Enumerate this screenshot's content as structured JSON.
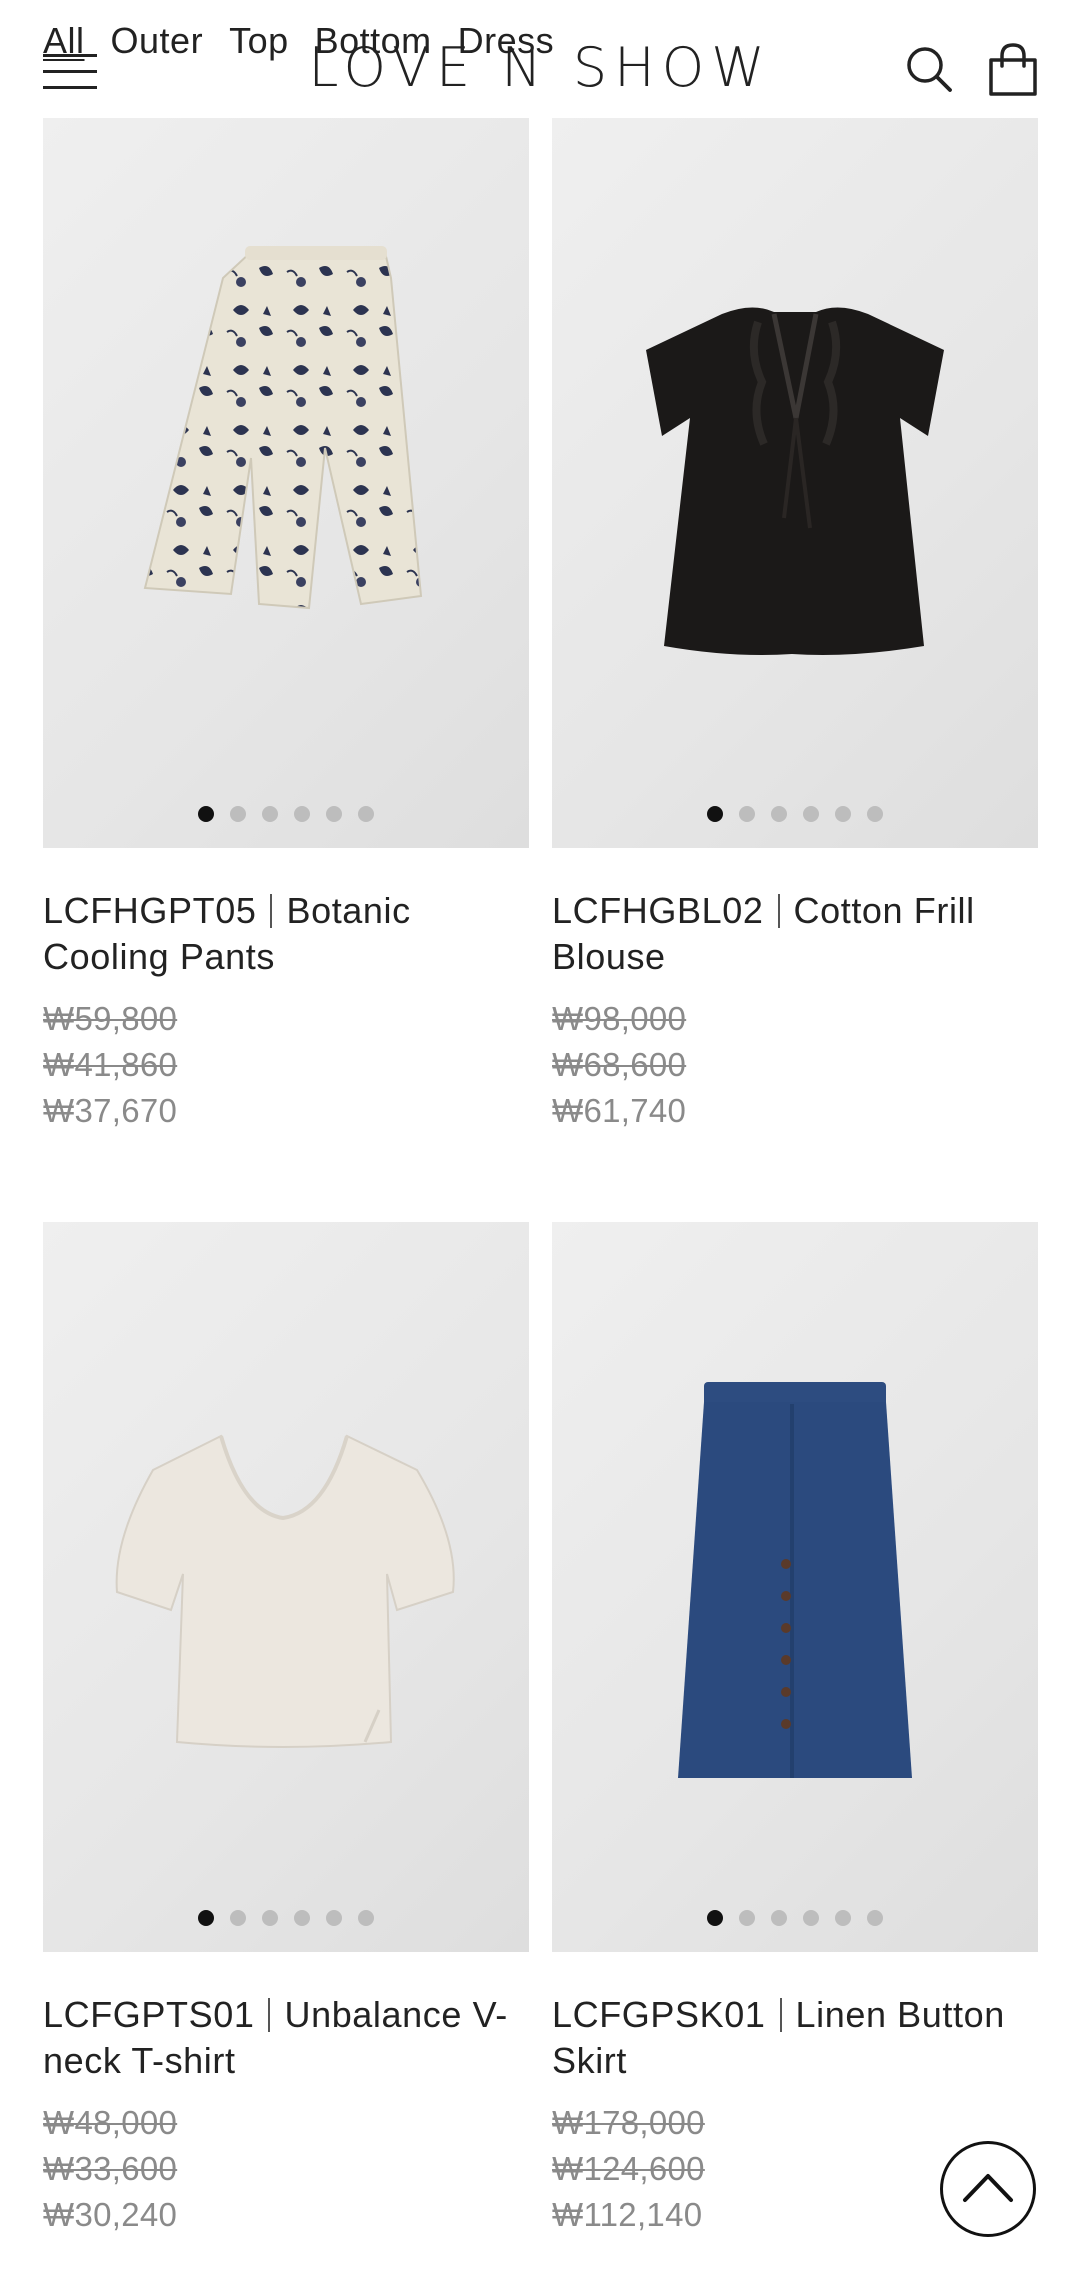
{
  "header": {
    "categories": [
      "All",
      "Outer",
      "Top",
      "Bottom",
      "Dress"
    ],
    "brand": "LOVE N SHOW"
  },
  "products": [
    {
      "code": "LCFHGPT05",
      "name": "Botanic Cooling Pants",
      "original_price": "₩59,800",
      "sale_price": "₩41,860",
      "member_price": "₩37,670",
      "slides": 6,
      "active_slide": 1
    },
    {
      "code": "LCFHGBL02",
      "name": "Cotton Frill Blouse",
      "original_price": "₩98,000",
      "sale_price": "₩68,600",
      "member_price": "₩61,740",
      "slides": 6,
      "active_slide": 1
    },
    {
      "code": "LCFGPTS01",
      "name": "Unbalance V-neck T-shirt",
      "original_price": "₩48,000",
      "sale_price": "₩33,600",
      "member_price": "₩30,240",
      "slides": 6,
      "active_slide": 1
    },
    {
      "code": "LCFGPSK01",
      "name": "Linen Button Skirt",
      "original_price": "₩178,000",
      "sale_price": "₩124,600",
      "member_price": "₩112,140",
      "slides": 6,
      "active_slide": 1
    }
  ],
  "icons": {
    "menu": "hamburger-menu-icon",
    "search": "search-icon",
    "bag": "shopping-bag-icon",
    "scroll_top": "chevron-up-icon"
  },
  "colors": {
    "text": "#222222",
    "price_gray": "#8a8a8a",
    "active_dot": "#111111",
    "inactive_dot": "#bdbdbd",
    "skirt_denim": "#2b4a7e",
    "blouse_black": "#1b1918",
    "tshirt_cream": "#ece7df"
  }
}
